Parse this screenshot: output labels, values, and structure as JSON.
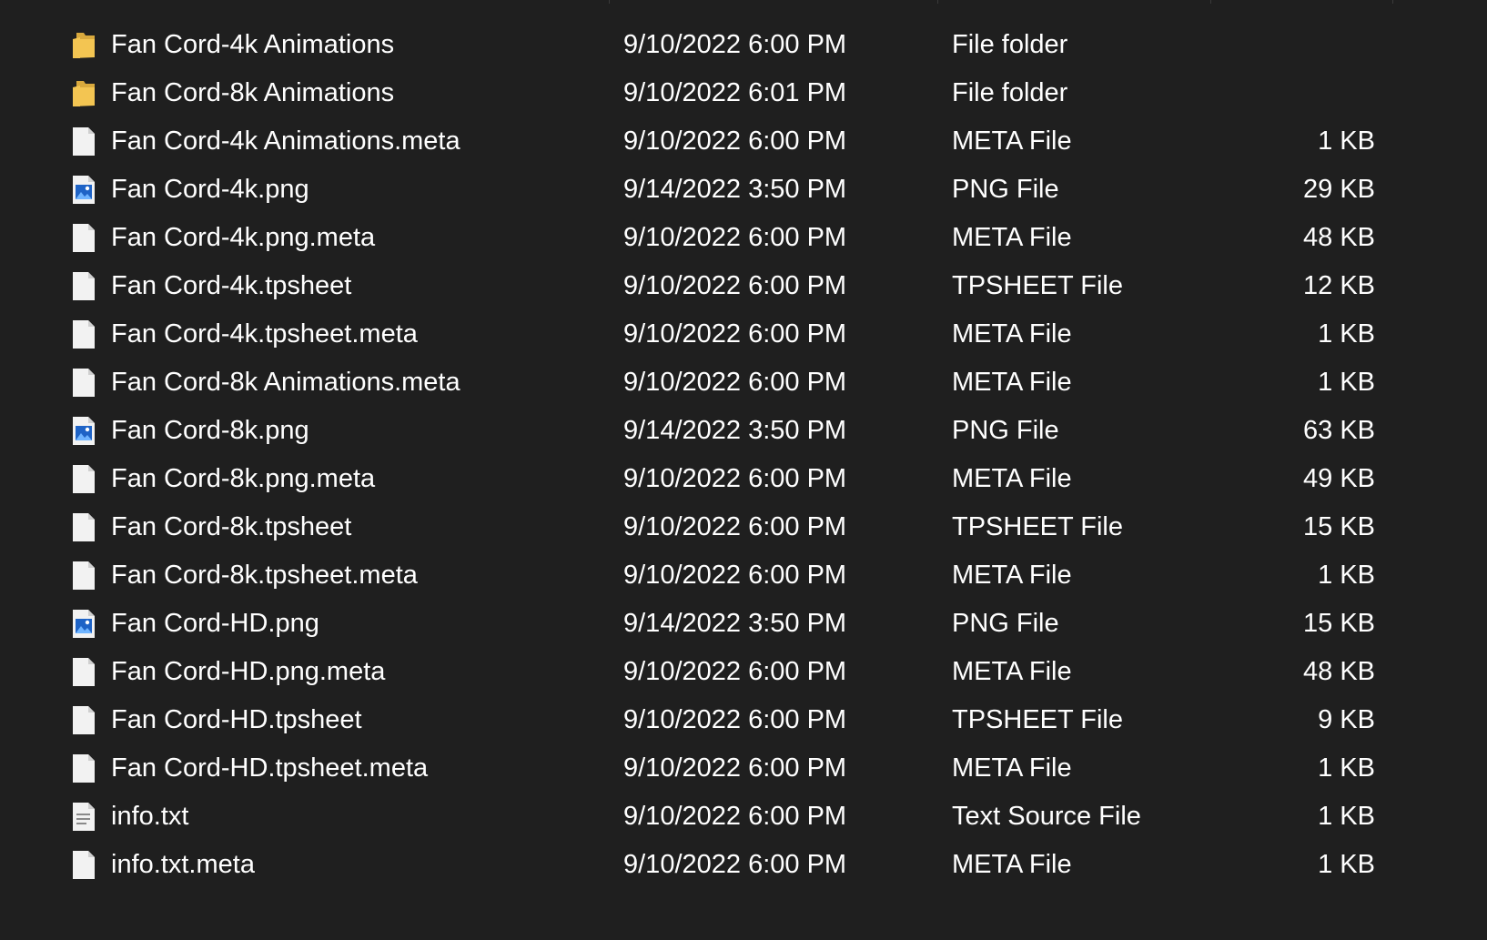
{
  "colors": {
    "background": "#1f1f1f",
    "text": "#ffffff",
    "folder": "#f3c552",
    "file": "#f2f2f2",
    "image_accent": "#1e63c6"
  },
  "files": [
    {
      "name": "Fan Cord-4k Animations",
      "date": "9/10/2022 6:00 PM",
      "type": "File folder",
      "size": "",
      "icon": "folder-icon"
    },
    {
      "name": "Fan Cord-8k Animations",
      "date": "9/10/2022 6:01 PM",
      "type": "File folder",
      "size": "",
      "icon": "folder-icon"
    },
    {
      "name": "Fan Cord-4k Animations.meta",
      "date": "9/10/2022 6:00 PM",
      "type": "META File",
      "size": "1 KB",
      "icon": "file-icon"
    },
    {
      "name": "Fan Cord-4k.png",
      "date": "9/14/2022 3:50 PM",
      "type": "PNG File",
      "size": "29 KB",
      "icon": "image-file-icon"
    },
    {
      "name": "Fan Cord-4k.png.meta",
      "date": "9/10/2022 6:00 PM",
      "type": "META File",
      "size": "48 KB",
      "icon": "file-icon"
    },
    {
      "name": "Fan Cord-4k.tpsheet",
      "date": "9/10/2022 6:00 PM",
      "type": "TPSHEET File",
      "size": "12 KB",
      "icon": "file-icon"
    },
    {
      "name": "Fan Cord-4k.tpsheet.meta",
      "date": "9/10/2022 6:00 PM",
      "type": "META File",
      "size": "1 KB",
      "icon": "file-icon"
    },
    {
      "name": "Fan Cord-8k Animations.meta",
      "date": "9/10/2022 6:00 PM",
      "type": "META File",
      "size": "1 KB",
      "icon": "file-icon"
    },
    {
      "name": "Fan Cord-8k.png",
      "date": "9/14/2022 3:50 PM",
      "type": "PNG File",
      "size": "63 KB",
      "icon": "image-file-icon"
    },
    {
      "name": "Fan Cord-8k.png.meta",
      "date": "9/10/2022 6:00 PM",
      "type": "META File",
      "size": "49 KB",
      "icon": "file-icon"
    },
    {
      "name": "Fan Cord-8k.tpsheet",
      "date": "9/10/2022 6:00 PM",
      "type": "TPSHEET File",
      "size": "15 KB",
      "icon": "file-icon"
    },
    {
      "name": "Fan Cord-8k.tpsheet.meta",
      "date": "9/10/2022 6:00 PM",
      "type": "META File",
      "size": "1 KB",
      "icon": "file-icon"
    },
    {
      "name": "Fan Cord-HD.png",
      "date": "9/14/2022 3:50 PM",
      "type": "PNG File",
      "size": "15 KB",
      "icon": "image-file-icon"
    },
    {
      "name": "Fan Cord-HD.png.meta",
      "date": "9/10/2022 6:00 PM",
      "type": "META File",
      "size": "48 KB",
      "icon": "file-icon"
    },
    {
      "name": "Fan Cord-HD.tpsheet",
      "date": "9/10/2022 6:00 PM",
      "type": "TPSHEET File",
      "size": "9 KB",
      "icon": "file-icon"
    },
    {
      "name": "Fan Cord-HD.tpsheet.meta",
      "date": "9/10/2022 6:00 PM",
      "type": "META File",
      "size": "1 KB",
      "icon": "file-icon"
    },
    {
      "name": "info.txt",
      "date": "9/10/2022 6:00 PM",
      "type": "Text Source File",
      "size": "1 KB",
      "icon": "text-file-icon"
    },
    {
      "name": "info.txt.meta",
      "date": "9/10/2022 6:00 PM",
      "type": "META File",
      "size": "1 KB",
      "icon": "file-icon"
    }
  ]
}
